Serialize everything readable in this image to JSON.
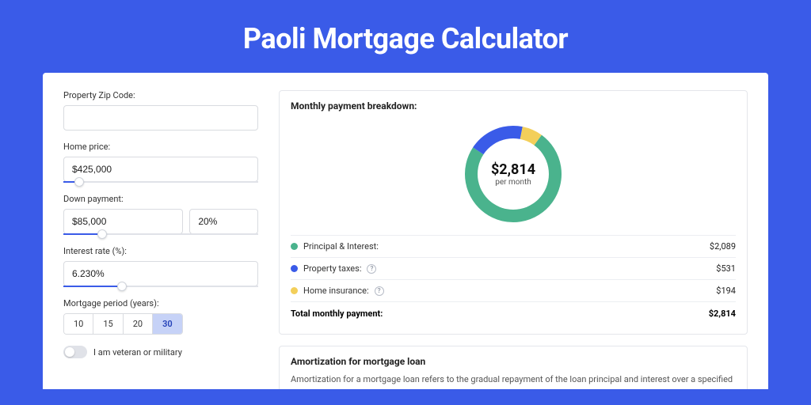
{
  "page_title": "Paoli Mortgage Calculator",
  "form": {
    "zip": {
      "label": "Property Zip Code:",
      "value": ""
    },
    "home_price": {
      "label": "Home price:",
      "value": "$425,000",
      "slider_pct": 8
    },
    "down_payment": {
      "label": "Down payment:",
      "value": "$85,000",
      "pct_value": "20%",
      "slider_pct": 20
    },
    "interest_rate": {
      "label": "Interest rate (%):",
      "value": "6.230%",
      "slider_pct": 30
    },
    "period": {
      "label": "Mortgage period (years):",
      "options": [
        "10",
        "15",
        "20",
        "30"
      ],
      "selected": "30"
    },
    "veteran": {
      "label": "I am veteran or military",
      "checked": false
    }
  },
  "breakdown": {
    "title": "Monthly payment breakdown:",
    "center_amount": "$2,814",
    "center_sub": "per month",
    "items": [
      {
        "label": "Principal & Interest:",
        "value": "$2,089",
        "color": "#4ab38d",
        "has_info": false
      },
      {
        "label": "Property taxes:",
        "value": "$531",
        "color": "#3a5be8",
        "has_info": true
      },
      {
        "label": "Home insurance:",
        "value": "$194",
        "color": "#f3cf5a",
        "has_info": true
      }
    ],
    "total_label": "Total monthly payment:",
    "total_value": "$2,814"
  },
  "chart_data": {
    "type": "pie",
    "title": "Monthly payment breakdown",
    "series": [
      {
        "name": "Principal & Interest",
        "value": 2089,
        "color": "#4ab38d"
      },
      {
        "name": "Property taxes",
        "value": 531,
        "color": "#3a5be8"
      },
      {
        "name": "Home insurance",
        "value": 194,
        "color": "#f3cf5a"
      }
    ],
    "total": 2814,
    "center_label": "$2,814 per month"
  },
  "amortization": {
    "title": "Amortization for mortgage loan",
    "text": "Amortization for a mortgage loan refers to the gradual repayment of the loan principal and interest over a specified"
  }
}
